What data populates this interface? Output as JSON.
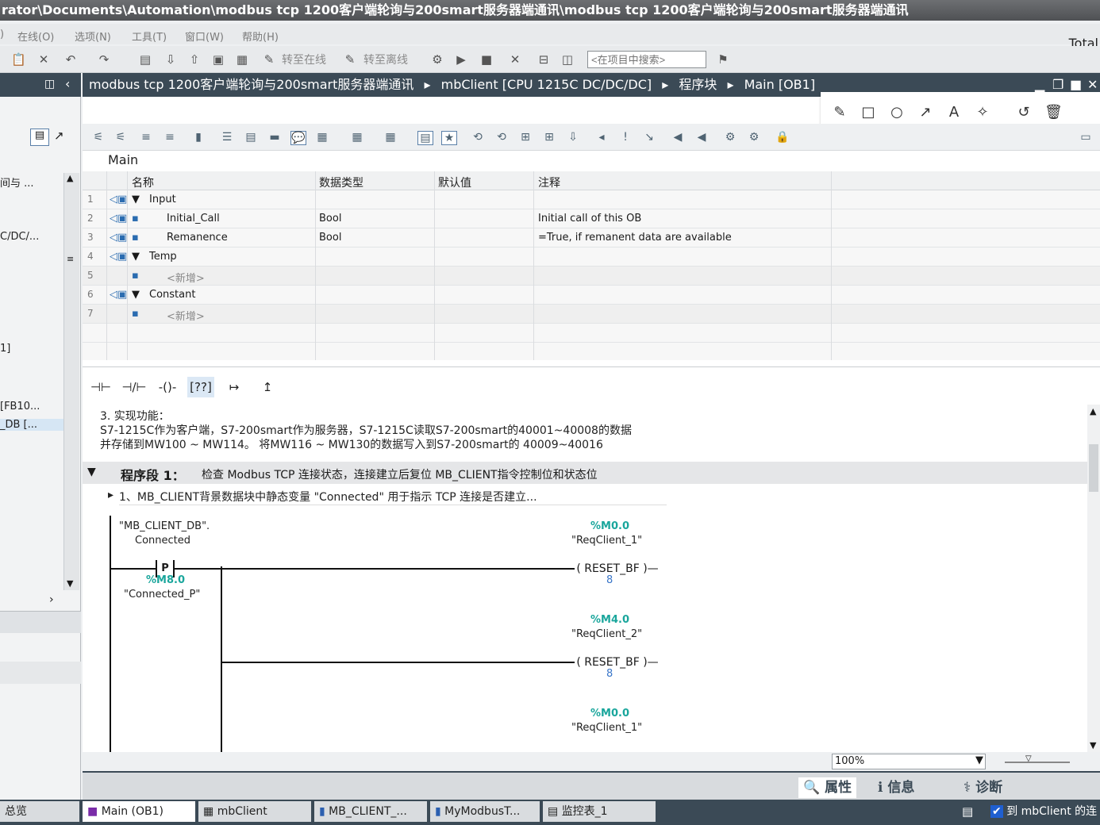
{
  "window": {
    "title": "rator\\Documents\\Automation\\modbus tcp 1200客户端轮询与200smart服务器端通讯\\modbus tcp 1200客户端轮询与200smart服务器端通讯",
    "product": "Total"
  },
  "menu": [
    "在线(O)",
    "选项(N)",
    "工具(T)",
    "窗口(W)",
    "帮助(H)"
  ],
  "toolbar": {
    "go_online": "转至在线",
    "go_offline": "转至离线",
    "search_placeholder": "<在项目中搜索>"
  },
  "left": {
    "items": [
      "间与 ...",
      "C/DC/...",
      "1]",
      "[FB10...",
      "_DB [..."
    ],
    "bottom": "总览"
  },
  "breadcrumb": [
    "modbus tcp 1200客户端轮询与200smart服务器端通讯",
    "mbClient [CPU 1215C DC/DC/DC]",
    "程序块",
    "Main [OB1]"
  ],
  "block": {
    "name": "Main"
  },
  "interface": {
    "headers": [
      "名称",
      "数据类型",
      "默认值",
      "注释"
    ],
    "rows": [
      {
        "n": "1",
        "name": "Input",
        "type": "",
        "default": "",
        "comment": ""
      },
      {
        "n": "2",
        "name": "Initial_Call",
        "type": "Bool",
        "default": "",
        "comment": "Initial call of this OB"
      },
      {
        "n": "3",
        "name": "Remanence",
        "type": "Bool",
        "default": "",
        "comment": "=True, if remanent data are available"
      },
      {
        "n": "4",
        "name": "Temp",
        "type": "",
        "default": "",
        "comment": ""
      },
      {
        "n": "5",
        "name": "<新增>",
        "type": "",
        "default": "",
        "comment": ""
      },
      {
        "n": "6",
        "name": "Constant",
        "type": "",
        "default": "",
        "comment": ""
      },
      {
        "n": "7",
        "name": "<新增>",
        "type": "",
        "default": "",
        "comment": ""
      }
    ]
  },
  "code": {
    "comment_lines": [
      "3. 实现功能：",
      "S7-1215C作为客户端，S7-200smart作为服务器，S7-1215C读取S7-200smart的40001~40008的数据",
      "并存储到MW100 ~ MW114。 将MW116 ~ MW130的数据写入到S7-200smart的 40009~40016"
    ],
    "network_label": "程序段 1：",
    "network_title": "检查 Modbus TCP 连接状态，连接建立后复位 MB_CLIENT指令控制位和状态位",
    "network_comment": "1、MB_CLIENT背景数据块中静态变量 \"Connected\" 用于指示 TCP 连接是否建立...",
    "contact": {
      "db": "\"MB_CLIENT_DB\".",
      "member": "Connected",
      "op": "P",
      "addr": "%M8.0",
      "tag": "\"Connected_P\""
    },
    "coils": [
      {
        "addr": "%M0.0",
        "tag": "\"ReqClient_1\"",
        "op": "RESET_BF",
        "count": "8"
      },
      {
        "addr": "%M4.0",
        "tag": "\"ReqClient_2\"",
        "op": "RESET_BF",
        "count": "8"
      },
      {
        "addr": "%M0.0",
        "tag": "\"ReqClient_1\""
      }
    ]
  },
  "zoom": "100%",
  "panels": [
    "属性",
    "信息",
    "诊断"
  ],
  "taskbar": {
    "items": [
      "Main (OB1)",
      "mbClient",
      "MB_CLIENT_...",
      "MyModbusT...",
      "监控表_1"
    ],
    "status": "到 mbClient 的连"
  }
}
